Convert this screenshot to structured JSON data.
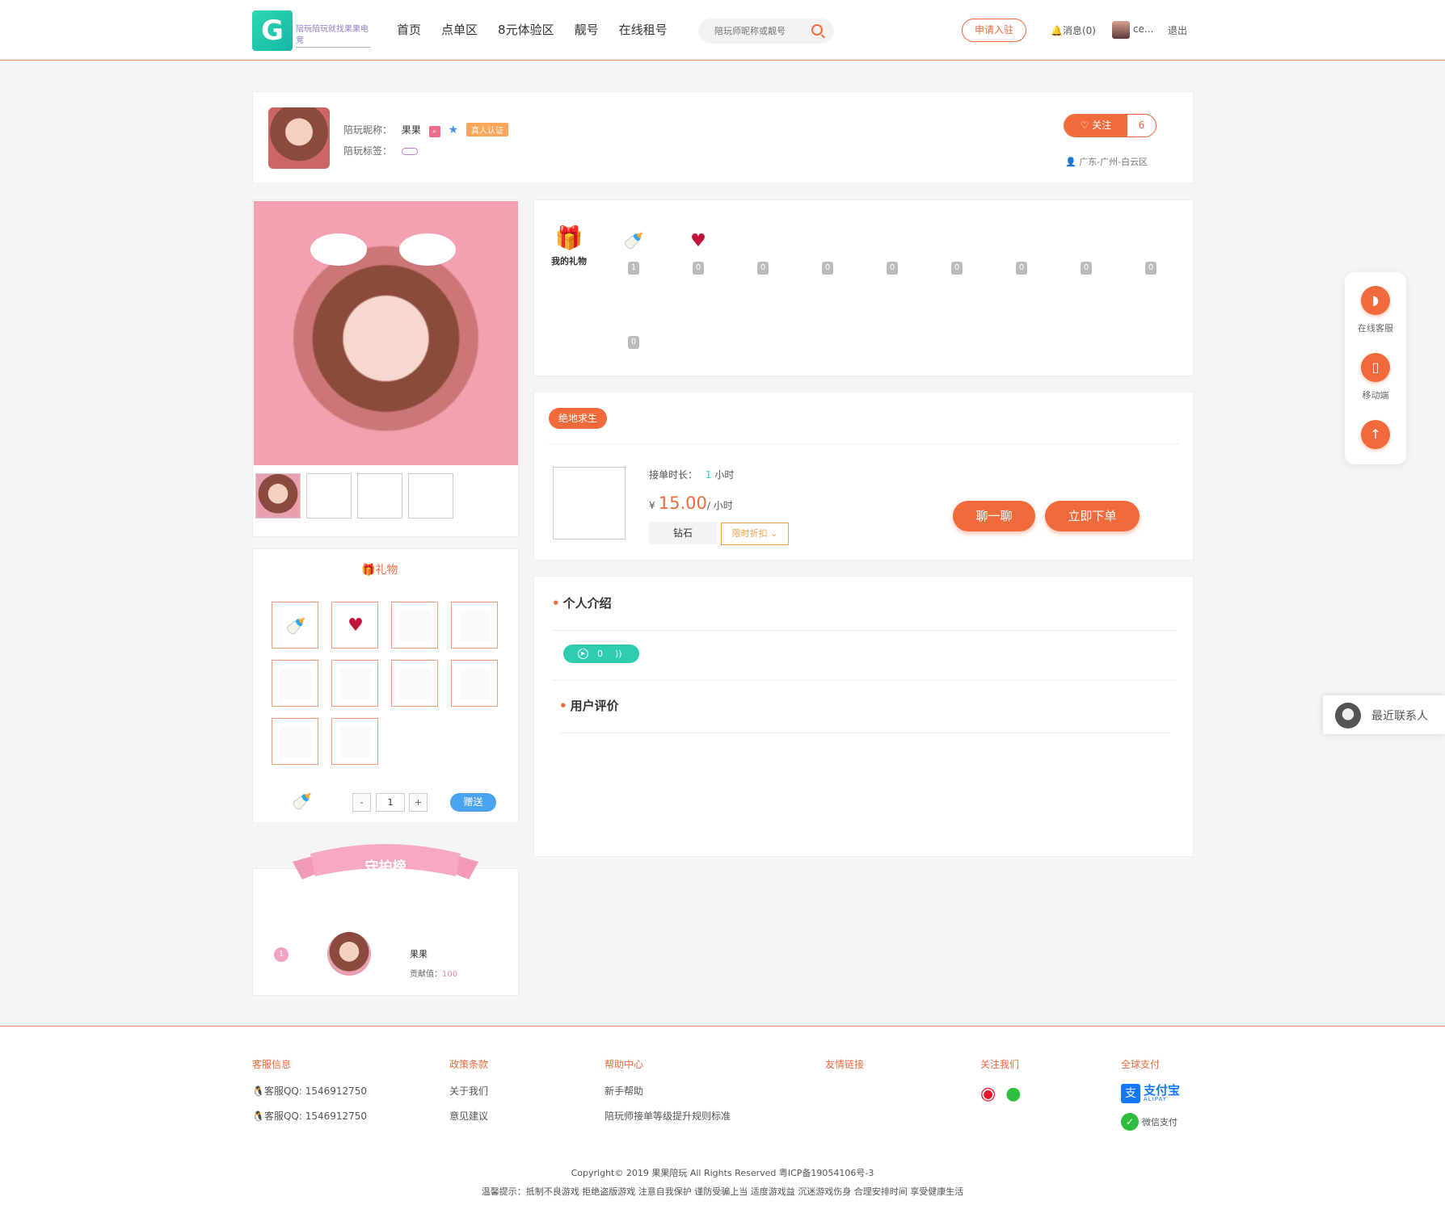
{
  "header": {
    "logo_text": "陪玩陪玩就找果果电竞",
    "nav": [
      "首页",
      "点单区",
      "8元体验区",
      "靓号",
      "在线租号"
    ],
    "search_placeholder": "陪玩师昵称或靓号",
    "apply_label": "申请入驻",
    "messages_label": "消息(0)",
    "username": "ce...",
    "logout_label": "退出"
  },
  "profile": {
    "nickname_label": "陪玩昵称：",
    "nickname": "果果",
    "auth_badge": "真人认证",
    "tags_label": "陪玩标签：",
    "follow_label": "关注",
    "follow_count": "6",
    "location": "广东-广州-白云区"
  },
  "gifts_summary": {
    "my_gifts_label": "我的礼物",
    "counts": [
      "1",
      "0",
      "0",
      "0",
      "0",
      "0",
      "0",
      "0",
      "0",
      "0"
    ]
  },
  "gift_box": {
    "title": "礼物",
    "quantity": "1",
    "minus": "-",
    "plus": "+",
    "give_label": "赠送"
  },
  "guard": {
    "title": "守护榜",
    "rank": "1",
    "name": "果果",
    "contribution_label": "贡献值：",
    "contribution_value": "100"
  },
  "order": {
    "game": "绝地求生",
    "duration_label": "接单时长：",
    "duration_value": "1",
    "duration_unit": "小时",
    "currency": "¥",
    "price": "15.00",
    "price_unit": "/ 小时",
    "level": "钻石",
    "discount_label": "限时折扣",
    "chat_label": "聊一聊",
    "order_label": "立即下单"
  },
  "intro": {
    "title": "个人介绍",
    "voice_count": "0",
    "reviews_title": "用户评价"
  },
  "sidebar": {
    "service_label": "在线客服",
    "mobile_label": "移动端",
    "recent_contacts": "最近联系人"
  },
  "footer": {
    "col1_title": "客服信息",
    "qq1": "客服QQ: 1546912750",
    "qq2": "客服QQ: 1546912750",
    "col2_title": "政策条款",
    "about": "关于我们",
    "feedback": "意见建议",
    "col3_title": "帮助中心",
    "newbie": "新手帮助",
    "upgrade_rules": "陪玩师接单等级提升规则标准",
    "col4_title": "友情链接",
    "col5_title": "关注我们",
    "col6_title": "全球支付",
    "alipay": "支付宝",
    "alipay_en": "ALIPAY",
    "wechat_pay": "微信支付",
    "copyright": "Copyright© 2019 果果陪玩 All Rights Reserved 粤ICP备19054106号-3",
    "notice": "温馨提示：抵制不良游戏 拒绝盗版游戏 注意自我保护 谨防受骗上当 适度游戏益 沉迷游戏伤身 合理安排时间 享受健康生活"
  },
  "colors": {
    "accent": "#f06a3c",
    "teal": "#2ecdb0",
    "blue": "#4aa3f0"
  }
}
